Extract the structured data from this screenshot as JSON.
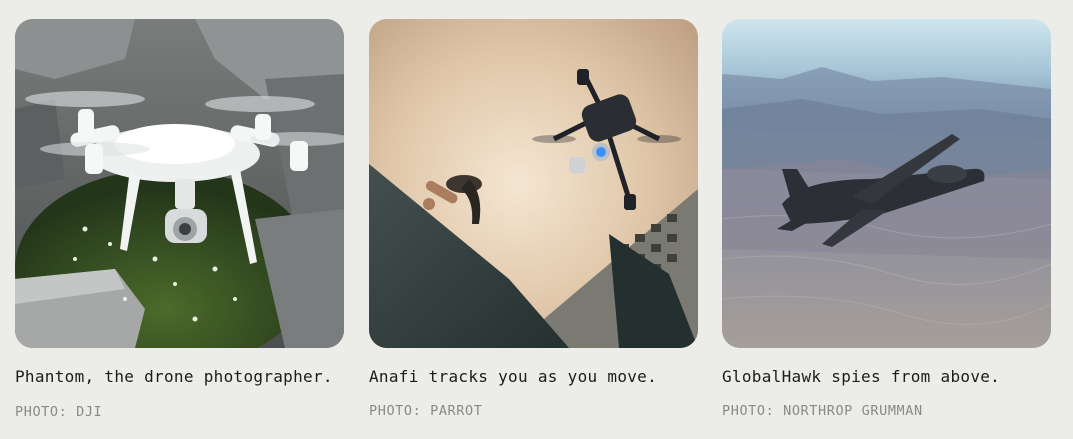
{
  "cards": [
    {
      "image_alt": "white quadcopter drone flying in rocky garden",
      "caption": "Phantom, the drone photographer.",
      "credit": "PHOTO: DJI"
    },
    {
      "image_alt": "small black drone following a person climbing a ramp",
      "caption": "Anafi tracks you as you move.",
      "credit": "PHOTO: PARROT"
    },
    {
      "image_alt": "military surveillance drone flying over mountains",
      "caption": "GlobalHawk spies from above.",
      "credit": "PHOTO: NORTHROP GRUMMAN"
    }
  ]
}
